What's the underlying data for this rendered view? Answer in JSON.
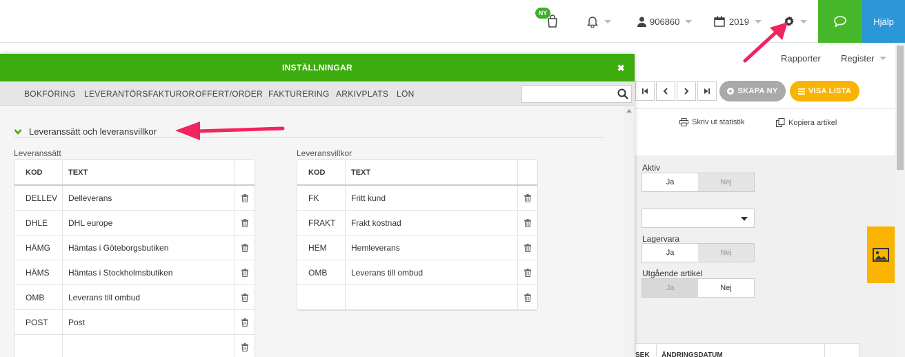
{
  "topbar": {
    "new_badge": "NY",
    "user_id": "906860",
    "year": "2019",
    "help_label": "Hjälp"
  },
  "background": {
    "menu": [
      "Rapporter",
      "Register"
    ],
    "create_new": "SKAPA NY",
    "show_list": "VISA LISTA",
    "print_stats": "Skriv ut statistik",
    "copy_article": "Kopiera artikel",
    "active_label": "Aktiv",
    "stock_label": "Lagervara",
    "expiring_label": "Utgående artikel",
    "yes": "Ja",
    "no": "Nej",
    "table_headers": [
      "SEK",
      "ÄNDRINGSDATUM"
    ]
  },
  "modal": {
    "title": "INSTÄLLNINGAR",
    "close": "✖",
    "tabs": [
      "BOKFÖRING",
      "LEVERANTÖRSFAKTUROR",
      "OFFERT/ORDER",
      "FAKTURERING",
      "ARKIVPLATS",
      "LÖN"
    ],
    "search_value": "",
    "section_title": "Leveranssätt och leveransvillkor"
  },
  "delivery_methods": {
    "label": "Leveranssätt",
    "headers": [
      "KOD",
      "TEXT"
    ],
    "rows": [
      {
        "code": "DELLEV",
        "text": "Delleverans"
      },
      {
        "code": "DHLE",
        "text": "DHL europe"
      },
      {
        "code": "HÄMG",
        "text": "Hämtas i Göteborgsbutiken"
      },
      {
        "code": "HÄMS",
        "text": "Hämtas i Stockholmsbutiken"
      },
      {
        "code": "OMB",
        "text": "Leverans till ombud"
      },
      {
        "code": "POST",
        "text": "Post"
      },
      {
        "code": "",
        "text": ""
      }
    ]
  },
  "delivery_terms": {
    "label": "Leveransvillkor",
    "headers": [
      "KOD",
      "TEXT"
    ],
    "rows": [
      {
        "code": "FK",
        "text": "Fritt kund"
      },
      {
        "code": "FRAKT",
        "text": "Frakt kostnad"
      },
      {
        "code": "HEM",
        "text": "Hemleverans"
      },
      {
        "code": "OMB",
        "text": "Leverans till ombud"
      },
      {
        "code": "",
        "text": ""
      }
    ]
  },
  "colors": {
    "accent_green": "#3dac0e",
    "help_blue": "#2b97d8",
    "orange": "#f8b400",
    "annotation_pink": "#f0245f"
  }
}
